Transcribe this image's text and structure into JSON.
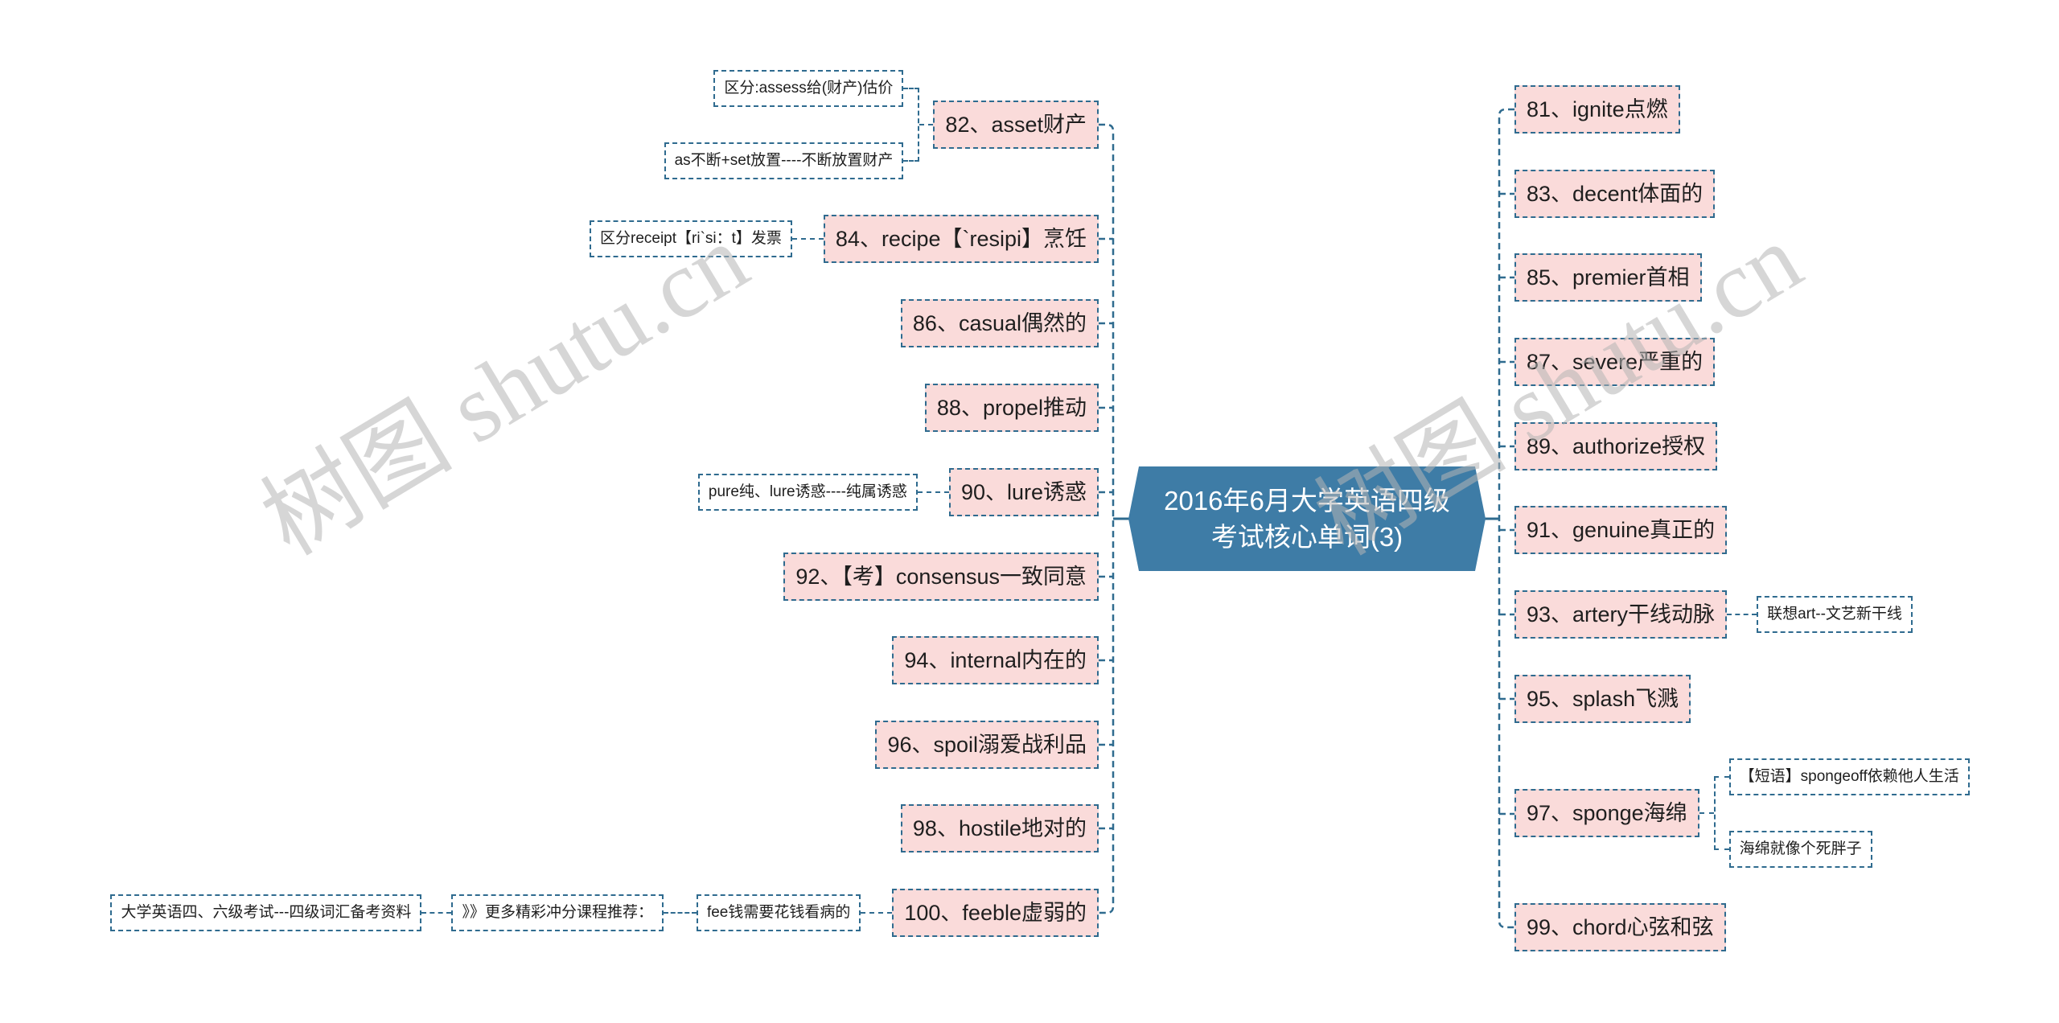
{
  "theme": {
    "center_fill": "#3e7ca6",
    "node_fill": "#fadbda",
    "line_color": "#2f6b8f",
    "text_color": "#1e1e1e"
  },
  "watermark": {
    "text": "树图 shutu.cn"
  },
  "center": {
    "line1": "2016年6月大学英语四级",
    "line2": "考试核心单词(3)"
  },
  "left": [
    {
      "label": "82、asset财产",
      "children": [
        {
          "label": "区分:assess给(财产)估价"
        },
        {
          "label": "as不断+set放置----不断放置财产"
        }
      ]
    },
    {
      "label": "84、recipe【`resipi】烹饪",
      "children": [
        {
          "label": "区分receipt【ri`si：t】发票"
        }
      ]
    },
    {
      "label": "86、casual偶然的"
    },
    {
      "label": "88、propel推动"
    },
    {
      "label": "90、lure诱惑",
      "children": [
        {
          "label": "pure纯、lure诱惑----纯属诱惑"
        }
      ]
    },
    {
      "label": "92、【考】consensus一致同意"
    },
    {
      "label": "94、internal内在的"
    },
    {
      "label": "96、spoil溺爱战利品"
    },
    {
      "label": "98、hostile地对的"
    },
    {
      "label": "100、feeble虚弱的",
      "children": [
        {
          "label": "fee钱需要花钱看病的",
          "children": [
            {
              "label": "》》更多精彩冲分课程推荐：",
              "children": [
                {
                  "label": "大学英语四、六级考试---四级词汇备考资料"
                }
              ]
            }
          ]
        }
      ]
    }
  ],
  "right": [
    {
      "label": "81、ignite点燃"
    },
    {
      "label": "83、decent体面的"
    },
    {
      "label": "85、premier首相"
    },
    {
      "label": "87、severe严重的"
    },
    {
      "label": "89、authorize授权"
    },
    {
      "label": "91、genuine真正的"
    },
    {
      "label": "93、artery干线动脉",
      "children": [
        {
          "label": "联想art--文艺新干线"
        }
      ]
    },
    {
      "label": "95、splash飞溅"
    },
    {
      "label": "97、sponge海绵",
      "children": [
        {
          "label": "【短语】spongeoff依赖他人生活"
        },
        {
          "label": "海绵就像个死胖子"
        }
      ]
    },
    {
      "label": "99、chord心弦和弦"
    }
  ]
}
